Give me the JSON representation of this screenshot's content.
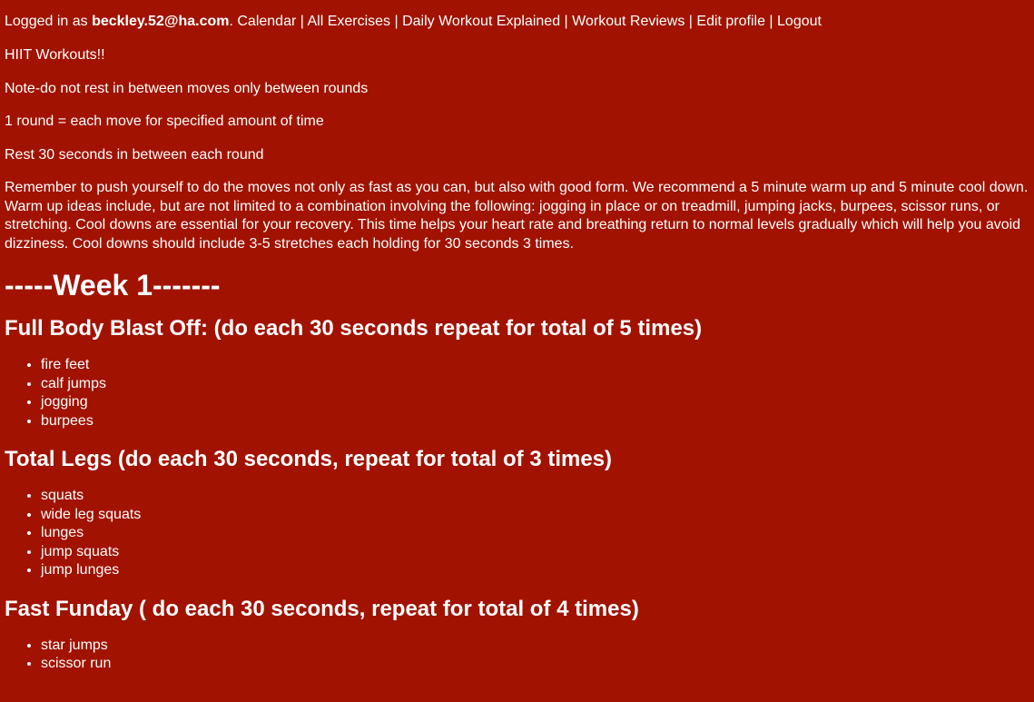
{
  "nav": {
    "logged_in_prefix": "Logged in as ",
    "user_email": "beckley.52@ha.com",
    "after_email": ". ",
    "links": [
      "Calendar",
      "All Exercises",
      "Daily Workout Explained",
      "Workout Reviews",
      "Edit profile",
      "Logout"
    ],
    "separator": " | "
  },
  "intro": {
    "title_line": "HIIT Workouts!!",
    "note_line": "Note-do not rest in between moves only between rounds",
    "round_line": "1 round = each move for specified amount of time",
    "rest_line": "Rest 30 seconds in between each round",
    "description": "Remember to push yourself to do the moves not only as fast as you can, but also with good form. We recommend a 5 minute warm up and 5 minute cool down. Warm up ideas include, but are not limited to a combination involving the following: jogging in place or on treadmill, jumping jacks, burpees, scissor runs, or stretching. Cool downs are essential for your recovery. This time helps your heart rate and breathing return to normal levels gradually which will help you avoid dizziness. Cool downs should include 3-5 stretches each holding for 30 seconds 3 times."
  },
  "week_heading": "-----Week 1-------",
  "workouts": [
    {
      "title": "Full Body Blast Off: (do each 30 seconds repeat for total of 5 times)",
      "moves": [
        "fire feet",
        "calf jumps",
        "jogging",
        "burpees"
      ]
    },
    {
      "title": "Total Legs (do each 30 seconds, repeat for total of 3 times)",
      "moves": [
        "squats",
        "wide leg squats",
        "lunges",
        "jump squats",
        "jump lunges"
      ]
    },
    {
      "title": "Fast Funday ( do each 30 seconds, repeat for total of 4 times)",
      "moves": [
        "star jumps",
        "scissor run"
      ]
    }
  ],
  "colors": {
    "background": "#a11200",
    "text": "#ffffff"
  }
}
